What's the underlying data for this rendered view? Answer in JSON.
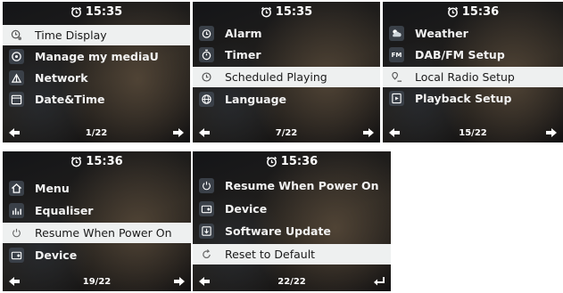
{
  "screens": [
    {
      "time": "15:35",
      "page": "1/22",
      "selected_index": 0,
      "items": [
        {
          "label": "Time Display",
          "icon": "clock-icon"
        },
        {
          "label": "Manage my mediaU",
          "icon": "media-icon"
        },
        {
          "label": "Network",
          "icon": "network-icon"
        },
        {
          "label": "Date&Time",
          "icon": "calendar-icon"
        }
      ],
      "left_arrow": "arrow-left-icon",
      "right_arrow": "arrow-right-icon"
    },
    {
      "time": "15:35",
      "page": "7/22",
      "selected_index": 2,
      "items": [
        {
          "label": "Alarm",
          "icon": "alarm-icon"
        },
        {
          "label": "Timer",
          "icon": "timer-icon"
        },
        {
          "label": "Scheduled Playing",
          "icon": "schedule-icon"
        },
        {
          "label": "Language",
          "icon": "globe-icon"
        }
      ],
      "left_arrow": "arrow-left-icon",
      "right_arrow": "arrow-right-icon"
    },
    {
      "time": "15:36",
      "page": "15/22",
      "selected_index": 2,
      "items": [
        {
          "label": "Weather",
          "icon": "weather-icon"
        },
        {
          "label": "DAB/FM Setup",
          "icon": "fm-icon"
        },
        {
          "label": "Local Radio Setup",
          "icon": "location-icon"
        },
        {
          "label": "Playback Setup",
          "icon": "playback-icon"
        }
      ],
      "left_arrow": "arrow-left-icon",
      "right_arrow": "arrow-right-icon"
    },
    {
      "time": "15:36",
      "page": "19/22",
      "selected_index": 2,
      "items": [
        {
          "label": "Menu",
          "icon": "home-icon"
        },
        {
          "label": "Equaliser",
          "icon": "equaliser-icon"
        },
        {
          "label": "Resume When Power On",
          "icon": "power-icon"
        },
        {
          "label": "Device",
          "icon": "device-icon"
        }
      ],
      "left_arrow": "arrow-left-icon",
      "right_arrow": "arrow-right-icon"
    },
    {
      "time": "15:36",
      "page": "22/22",
      "selected_index": 3,
      "items": [
        {
          "label": "Resume When Power On",
          "icon": "power-icon"
        },
        {
          "label": "Device",
          "icon": "device-icon"
        },
        {
          "label": "Software Update",
          "icon": "update-icon"
        },
        {
          "label": "Reset to Default",
          "icon": "reset-icon"
        }
      ],
      "left_arrow": "arrow-left-icon",
      "right_arrow": "enter-icon"
    }
  ]
}
